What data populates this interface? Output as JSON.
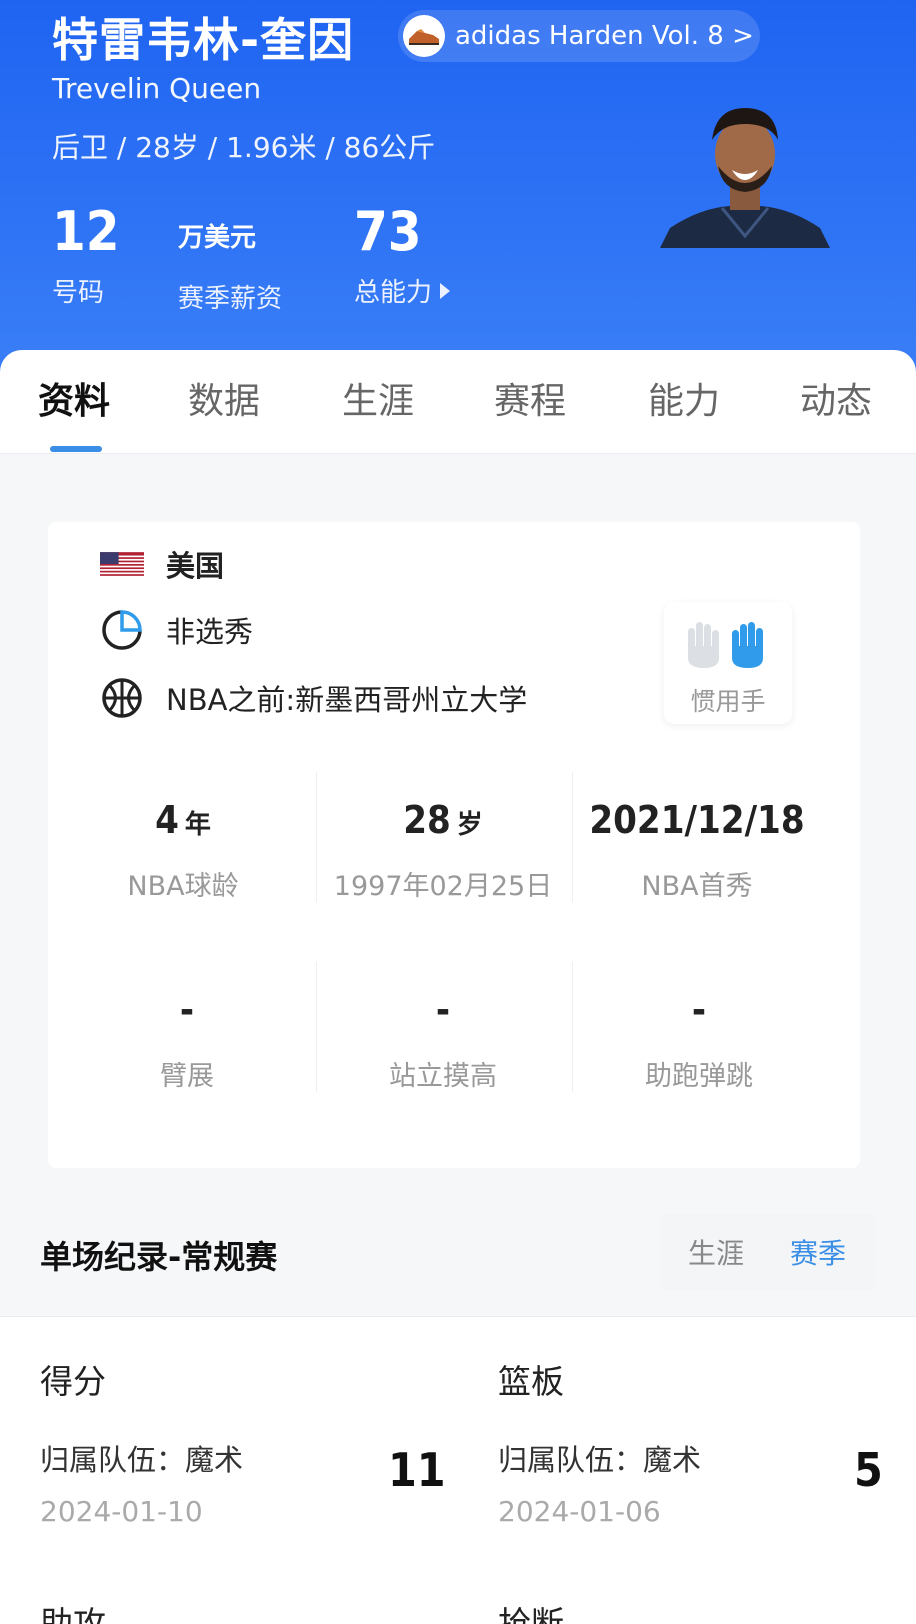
{
  "player": {
    "name_cn": "特雷韦林-奎因",
    "name_en": "Trevelin Queen",
    "meta": "后卫 / 28岁 / 1.96米 / 86公斤"
  },
  "shoe": {
    "label": "adidas Harden Vol. 8 >"
  },
  "stats": [
    {
      "value": "12",
      "label": "号码"
    },
    {
      "value": "万美元",
      "label": "赛季薪资"
    },
    {
      "value": "73",
      "label": "总能力"
    }
  ],
  "tabs": [
    "资料",
    "数据",
    "生涯",
    "赛程",
    "能力",
    "动态"
  ],
  "info": {
    "country": "美国",
    "draft": "非选秀",
    "college": "NBA之前:新墨西哥州立大学",
    "hand_label": "惯用手"
  },
  "grid": [
    {
      "value": "4",
      "unit": "年",
      "label": "NBA球龄"
    },
    {
      "value": "28",
      "unit": "岁",
      "label": "1997年02月25日"
    },
    {
      "value": "2021/12/18",
      "unit": "",
      "label": "NBA首秀"
    },
    {
      "value": "-",
      "unit": "",
      "label": "臂展"
    },
    {
      "value": "-",
      "unit": "",
      "label": "站立摸高"
    },
    {
      "value": "-",
      "unit": "",
      "label": "助跑弹跳"
    }
  ],
  "records": {
    "title": "单场纪录-常规赛",
    "toggle": [
      "生涯",
      "赛季"
    ],
    "items": [
      {
        "category": "得分",
        "team": "归属队伍：魔术",
        "date": "2024-01-10",
        "value": "11"
      },
      {
        "category": "篮板",
        "team": "归属队伍：魔术",
        "date": "2024-01-06",
        "value": "5"
      }
    ],
    "next_categories": [
      "助攻",
      "抢断"
    ]
  },
  "colors": {
    "header_blue": "#2a6ef3",
    "accent": "#3a8ee6",
    "hand_active": "#2f9bea"
  }
}
